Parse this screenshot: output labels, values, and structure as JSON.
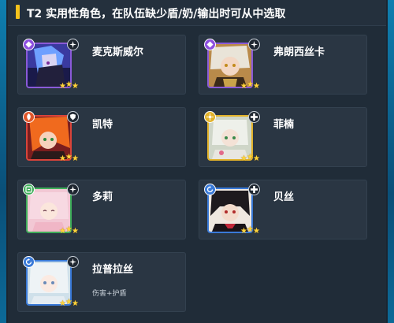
{
  "header": {
    "title": "T2 实用性角色，在队伍缺少盾/奶/输出时可从中选取"
  },
  "colors": {
    "accent_bar": "#f6c21c",
    "star": "#ffd43a",
    "panel_bg": "#202c38",
    "card_bg": "#2a3643"
  },
  "characters": [
    {
      "name": "麦克斯威尔",
      "desc": "",
      "role_icon": "purple-class-icon",
      "element_icon": "star-element-icon",
      "stars": 3
    },
    {
      "name": "弗朗西丝卡",
      "desc": "",
      "role_icon": "purple-class-icon",
      "element_icon": "star-element-icon",
      "stars": 3
    },
    {
      "name": "凯特",
      "desc": "",
      "role_icon": "orange-class-icon",
      "element_icon": "shield-element-icon",
      "stars": 3
    },
    {
      "name": "菲楠",
      "desc": "",
      "role_icon": "yellow-class-icon",
      "element_icon": "cross-element-icon",
      "stars": 3
    },
    {
      "name": "多莉",
      "desc": "",
      "role_icon": "green-class-icon",
      "element_icon": "star-element-icon",
      "stars": 3
    },
    {
      "name": "贝丝",
      "desc": "",
      "role_icon": "blue-class-icon",
      "element_icon": "cross-element-icon",
      "stars": 3
    },
    {
      "name": "拉普拉丝",
      "desc": "伤害+护盾",
      "role_icon": "blue-class-icon",
      "element_icon": "star-element-icon",
      "stars": 3
    }
  ]
}
